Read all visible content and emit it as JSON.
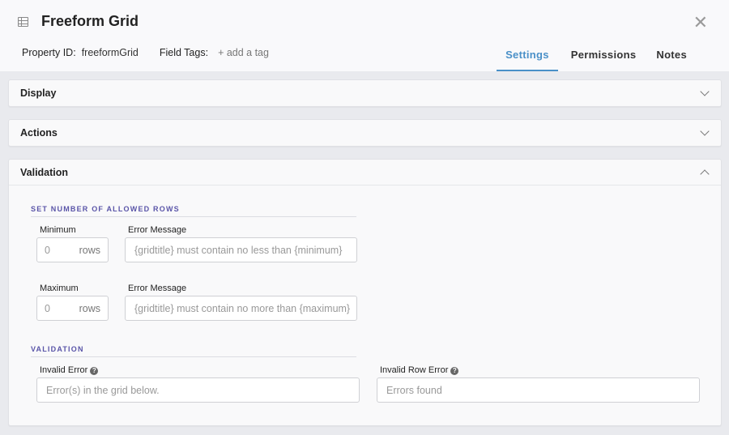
{
  "header": {
    "icon": "grid-icon",
    "title": "Freeform Grid",
    "close_icon": "close-icon",
    "property_id_label": "Property ID:",
    "property_id_value": "freeformGrid",
    "field_tags_label": "Field Tags:",
    "add_tag_label": "+ add a tag"
  },
  "tabs": [
    {
      "label": "Settings",
      "active": true
    },
    {
      "label": "Permissions",
      "active": false
    },
    {
      "label": "Notes",
      "active": false
    }
  ],
  "sections": {
    "display": {
      "title": "Display",
      "expanded": false
    },
    "actions": {
      "title": "Actions",
      "expanded": false
    },
    "validation": {
      "title": "Validation",
      "expanded": true
    }
  },
  "validation": {
    "rows_group_label": "SET NUMBER OF ALLOWED ROWS",
    "minimum": {
      "label": "Minimum",
      "placeholder": "0",
      "suffix": "rows",
      "error_label": "Error Message",
      "error_placeholder": "{gridtitle} must contain no less than {minimum}"
    },
    "maximum": {
      "label": "Maximum",
      "placeholder": "0",
      "suffix": "rows",
      "error_label": "Error Message",
      "error_placeholder": "{gridtitle} must contain no more than {maximum}"
    },
    "validation_group_label": "VALIDATION",
    "invalid_error": {
      "label": "Invalid Error",
      "placeholder": "Error(s) in the grid below."
    },
    "invalid_row_error": {
      "label": "Invalid Row Error",
      "placeholder": "Errors found"
    },
    "help_glyph": "?"
  },
  "colors": {
    "accent": "#4a90c8",
    "group_label": "#5a55a8"
  }
}
